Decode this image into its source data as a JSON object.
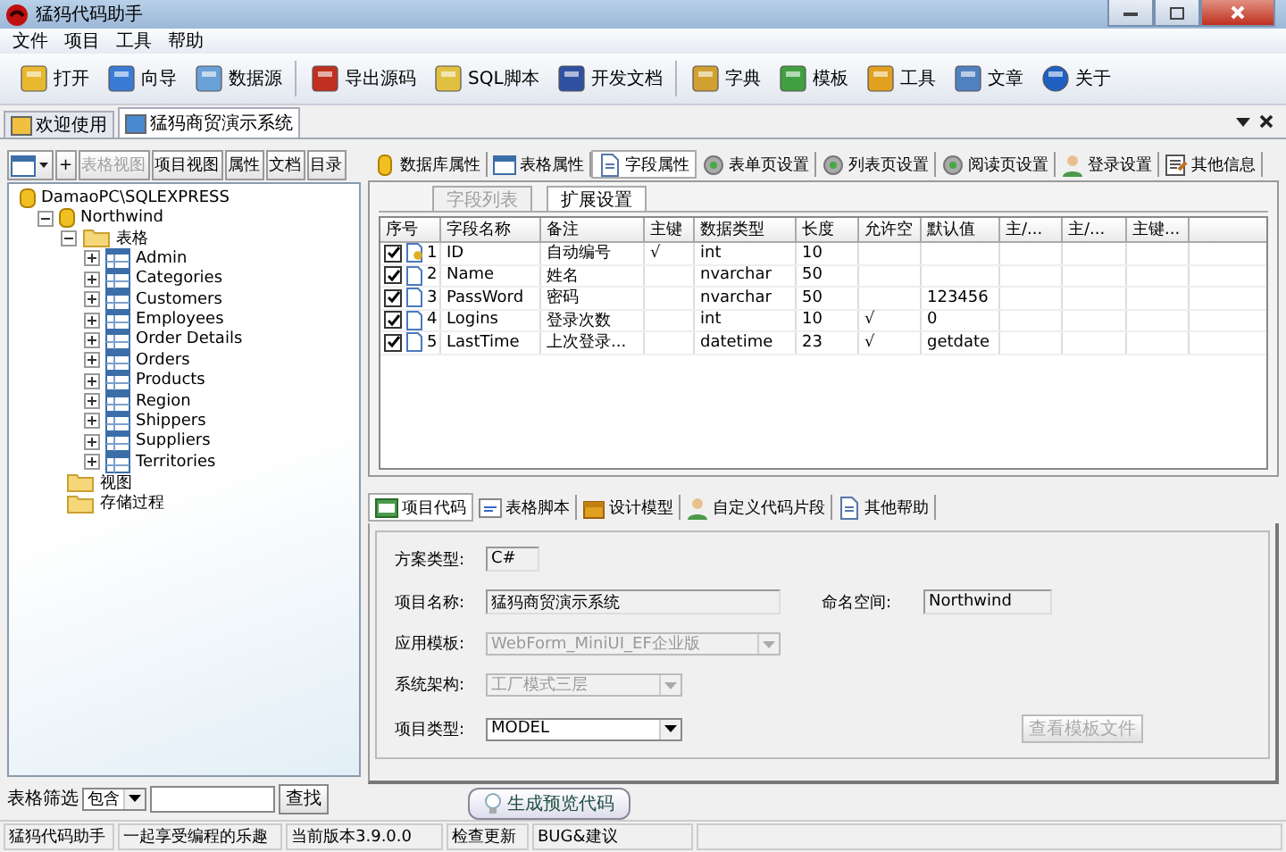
{
  "window": {
    "title": "猛犸代码助手"
  },
  "menu": [
    "文件",
    "项目",
    "工具",
    "帮助"
  ],
  "toolbar": [
    "打开",
    "向导",
    "数据源",
    "导出源码",
    "SQL脚本",
    "开发文档",
    "字典",
    "模板",
    "工具",
    "文章",
    "关于"
  ],
  "doc_tabs": [
    {
      "label": "欢迎使用",
      "selected": false
    },
    {
      "label": "猛犸商贸演示系统",
      "selected": true
    }
  ],
  "left": {
    "view_buttons": [
      {
        "label": "+",
        "disabled": false
      },
      {
        "label": "表格视图",
        "disabled": true
      },
      {
        "label": "项目视图",
        "disabled": false
      },
      {
        "label": "属性",
        "disabled": false
      },
      {
        "label": "文档",
        "disabled": false
      },
      {
        "label": "目录",
        "disabled": false
      }
    ],
    "tree": [
      {
        "label": "DamaoPC\\SQLEXPRESS",
        "kind": "db",
        "children": [
          {
            "label": "Northwind",
            "kind": "db",
            "expanded": true,
            "children": [
              {
                "label": "表格",
                "kind": "folder",
                "expanded": true,
                "children": [
                  {
                    "label": "Admin",
                    "kind": "table",
                    "expanded": false
                  },
                  {
                    "label": "Categories",
                    "kind": "table",
                    "expanded": false
                  },
                  {
                    "label": "Customers",
                    "kind": "table",
                    "expanded": false
                  },
                  {
                    "label": "Employees",
                    "kind": "table",
                    "expanded": false
                  },
                  {
                    "label": "Order Details",
                    "kind": "table",
                    "expanded": false
                  },
                  {
                    "label": "Orders",
                    "kind": "table",
                    "expanded": false
                  },
                  {
                    "label": "Products",
                    "kind": "table",
                    "expanded": false
                  },
                  {
                    "label": "Region",
                    "kind": "table",
                    "expanded": false
                  },
                  {
                    "label": "Shippers",
                    "kind": "table",
                    "expanded": false
                  },
                  {
                    "label": "Suppliers",
                    "kind": "table",
                    "expanded": false
                  },
                  {
                    "label": "Territories",
                    "kind": "table",
                    "expanded": false
                  }
                ]
              },
              {
                "label": "视图",
                "kind": "folder"
              },
              {
                "label": "存储过程",
                "kind": "folder"
              }
            ]
          }
        ]
      }
    ],
    "filter": {
      "label": "表格筛选",
      "mode": "包含",
      "button": "查找"
    }
  },
  "prop_tabs": [
    {
      "label": "数据库属性",
      "selected": false
    },
    {
      "label": "表格属性",
      "selected": false
    },
    {
      "label": "字段属性",
      "selected": true
    },
    {
      "label": "表单页设置",
      "selected": false
    },
    {
      "label": "列表页设置",
      "selected": false
    },
    {
      "label": "阅读页设置",
      "selected": false
    },
    {
      "label": "登录设置",
      "selected": false
    },
    {
      "label": "其他信息",
      "selected": false
    }
  ],
  "sub_tabs": [
    {
      "label": "字段列表",
      "selected": false
    },
    {
      "label": "扩展设置",
      "selected": true
    }
  ],
  "table": {
    "columns": [
      "序号",
      "字段名称",
      "备注",
      "主键",
      "数据类型",
      "长度",
      "允许空",
      "默认值",
      "主/...",
      "主/...",
      "主键..."
    ],
    "rows": [
      {
        "checked": true,
        "key": true,
        "no": "1",
        "name": "ID",
        "note": "自动编号",
        "pk": "√",
        "type": "int",
        "length": "10",
        "nullable": "",
        "default": ""
      },
      {
        "checked": true,
        "key": false,
        "no": "2",
        "name": "Name",
        "note": "姓名",
        "pk": "",
        "type": "nvarchar",
        "length": "50",
        "nullable": "",
        "default": ""
      },
      {
        "checked": true,
        "key": false,
        "no": "3",
        "name": "PassWord",
        "note": "密码",
        "pk": "",
        "type": "nvarchar",
        "length": "50",
        "nullable": "",
        "default": "123456"
      },
      {
        "checked": true,
        "key": false,
        "no": "4",
        "name": "Logins",
        "note": "登录次数",
        "pk": "",
        "type": "int",
        "length": "10",
        "nullable": "√",
        "default": "0"
      },
      {
        "checked": true,
        "key": false,
        "no": "5",
        "name": "LastTime",
        "note": "上次登录...",
        "pk": "",
        "type": "datetime",
        "length": "23",
        "nullable": "√",
        "default": "getdate"
      }
    ]
  },
  "code_tabs": [
    {
      "label": "项目代码",
      "selected": true
    },
    {
      "label": "表格脚本",
      "selected": false
    },
    {
      "label": "设计模型",
      "selected": false
    },
    {
      "label": "自定义代码片段",
      "selected": false
    },
    {
      "label": "其他帮助",
      "selected": false
    }
  ],
  "form": {
    "scheme": {
      "label": "方案类型:",
      "value": "C#"
    },
    "project_name": {
      "label": "项目名称:",
      "value": "猛犸商贸演示系统"
    },
    "namespace": {
      "label": "命名空间:",
      "value": "Northwind"
    },
    "template": {
      "label": "应用模板:",
      "value": "WebForm_MiniUI_EF企业版",
      "disabled": true
    },
    "architecture": {
      "label": "系统架构:",
      "value": "工厂模式三层",
      "disabled": true
    },
    "project_type": {
      "label": "项目类型:",
      "value": "MODEL",
      "disabled": false
    },
    "view_template_button": {
      "label": "查看模板文件",
      "disabled": true
    }
  },
  "generate_button": "生成预览代码",
  "status_bar": [
    "猛犸代码助手",
    "一起享受编程的乐趣",
    "当前版本3.9.0.0",
    "检查更新",
    "BUG&建议"
  ]
}
